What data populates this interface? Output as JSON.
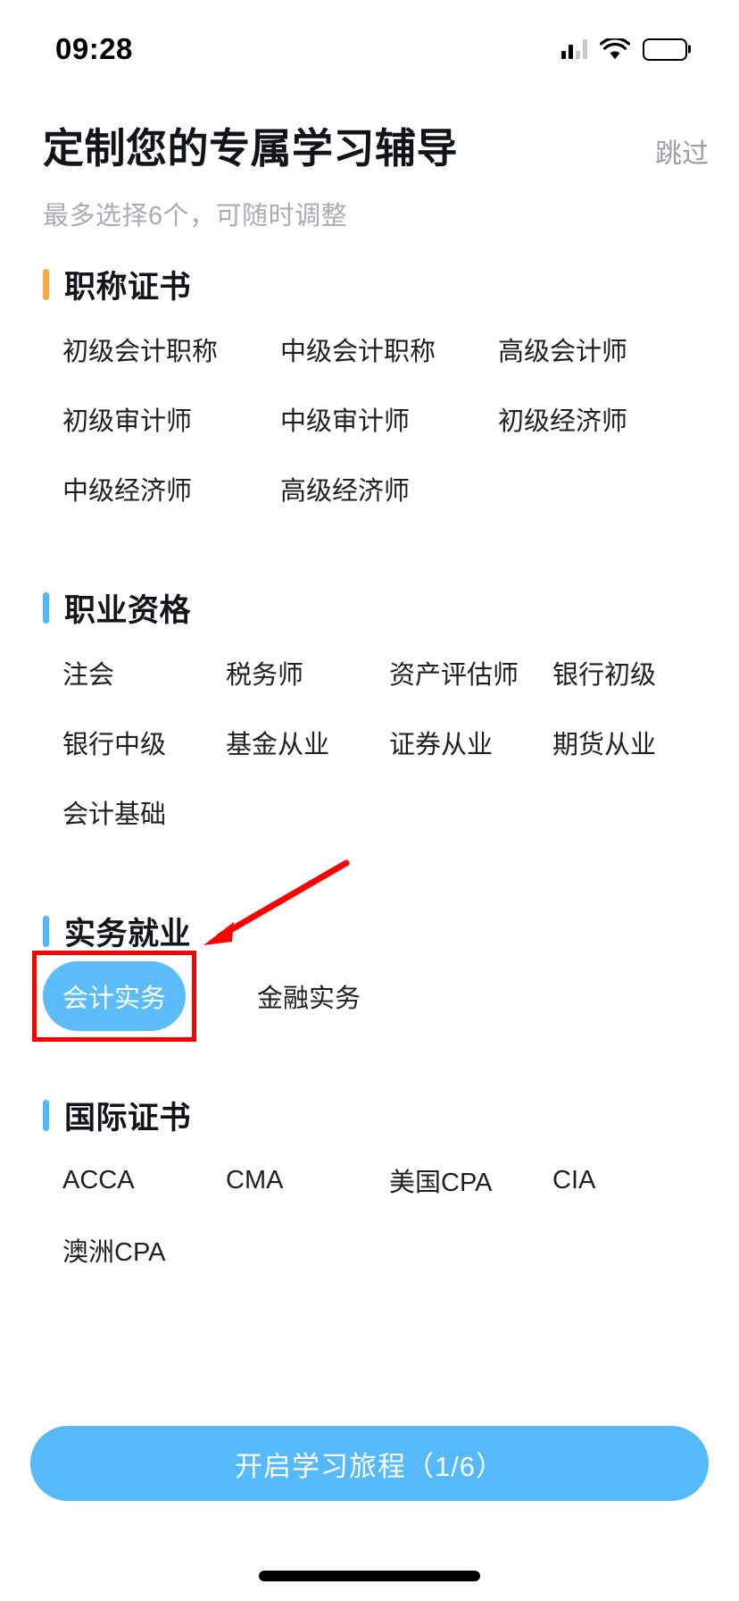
{
  "status_bar": {
    "time": "09:28",
    "icons": [
      "signal-icon",
      "wifi-icon",
      "battery-icon"
    ]
  },
  "header": {
    "title": "定制您的专属学习辅导",
    "skip_label": "跳过",
    "subtitle": "最多选择6个，可随时调整"
  },
  "colors": {
    "accent_blue": "#56b9fa",
    "marker_orange": "#f7a93b",
    "marker_blue": "#4db8f5",
    "annotation_red": "#ff0000",
    "title_text": "#111418",
    "muted_text": "#a8adb3"
  },
  "sections": [
    {
      "title": "职称证书",
      "marker_color": "#f7a93b",
      "layout": "cols-3",
      "items": [
        {
          "label": "初级会计职称",
          "selected": false
        },
        {
          "label": "中级会计职称",
          "selected": false
        },
        {
          "label": "高级会计师",
          "selected": false
        },
        {
          "label": "初级审计师",
          "selected": false
        },
        {
          "label": "中级审计师",
          "selected": false
        },
        {
          "label": "初级经济师",
          "selected": false
        },
        {
          "label": "中级经济师",
          "selected": false
        },
        {
          "label": "高级经济师",
          "selected": false
        }
      ]
    },
    {
      "title": "职业资格",
      "marker_color": "#4db8f5",
      "layout": "cols-4",
      "items": [
        {
          "label": "注会",
          "selected": false
        },
        {
          "label": "税务师",
          "selected": false
        },
        {
          "label": "资产评估师",
          "selected": false
        },
        {
          "label": "银行初级",
          "selected": false
        },
        {
          "label": "银行中级",
          "selected": false
        },
        {
          "label": "基金从业",
          "selected": false
        },
        {
          "label": "证券从业",
          "selected": false
        },
        {
          "label": "期货从业",
          "selected": false
        },
        {
          "label": "会计基础",
          "selected": false
        }
      ]
    },
    {
      "title": "实务就业",
      "marker_color": "#4db8f5",
      "layout": "free",
      "items": [
        {
          "label": "会计实务",
          "selected": true
        },
        {
          "label": "金融实务",
          "selected": false
        }
      ]
    },
    {
      "title": "国际证书",
      "marker_color": "#4db8f5",
      "layout": "cols-4",
      "items": [
        {
          "label": "ACCA",
          "selected": false
        },
        {
          "label": "CMA",
          "selected": false
        },
        {
          "label": "美国CPA",
          "selected": false
        },
        {
          "label": "CIA",
          "selected": false
        },
        {
          "label": "澳洲CPA",
          "selected": false
        }
      ]
    }
  ],
  "cta": {
    "label": "开启学习旅程（1/6）"
  },
  "annotation": {
    "highlight_target": "会计实务",
    "box_color": "#ff0000",
    "arrow_color": "#ff0000"
  }
}
